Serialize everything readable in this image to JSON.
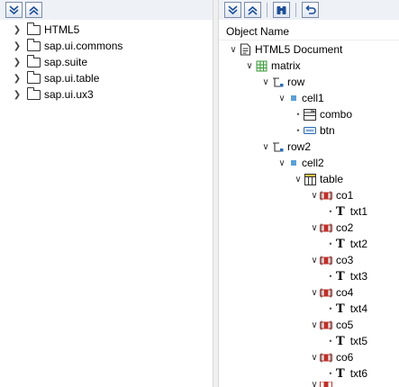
{
  "left_tree": {
    "items": [
      {
        "label": "HTML5"
      },
      {
        "label": "sap.ui.commons"
      },
      {
        "label": "sap.suite"
      },
      {
        "label": "sap.ui.table"
      },
      {
        "label": "sap.ui.ux3"
      }
    ]
  },
  "right_tree": {
    "column_header": "Object Name",
    "nodes": [
      {
        "label": "HTML5 Document",
        "icon": "document-icon"
      },
      {
        "label": "matrix",
        "icon": "matrix-layout-icon"
      },
      {
        "label": "row",
        "icon": "row-icon"
      },
      {
        "label": "cell1",
        "icon": "cell-icon"
      },
      {
        "label": "combo",
        "icon": "combobox-icon"
      },
      {
        "label": "btn",
        "icon": "button-icon"
      },
      {
        "label": "row2",
        "icon": "row-icon"
      },
      {
        "label": "cell2",
        "icon": "cell-icon"
      },
      {
        "label": "table",
        "icon": "table-icon"
      },
      {
        "label": "co1",
        "icon": "column-icon"
      },
      {
        "label": "txt1",
        "icon": "text-icon"
      },
      {
        "label": "co2",
        "icon": "column-icon"
      },
      {
        "label": "txt2",
        "icon": "text-icon"
      },
      {
        "label": "co3",
        "icon": "column-icon"
      },
      {
        "label": "txt3",
        "icon": "text-icon"
      },
      {
        "label": "co4",
        "icon": "column-icon"
      },
      {
        "label": "txt4",
        "icon": "text-icon"
      },
      {
        "label": "co5",
        "icon": "column-icon"
      },
      {
        "label": "txt5",
        "icon": "text-icon"
      },
      {
        "label": "co6",
        "icon": "column-icon"
      },
      {
        "label": "txt6",
        "icon": "text-icon"
      }
    ]
  },
  "toolbar_icons": {
    "expand_all": "expand-all-icon",
    "collapse_all": "collapse-all-icon",
    "find": "binoculars-icon",
    "refresh": "refresh-icon"
  },
  "colors": {
    "toolbar_bg": "#eef1f6",
    "accent_blue": "#2f6db5",
    "cell_blue": "#5ba0d6",
    "column_red": "#c0302a",
    "matrix_green": "#3c9a3c"
  }
}
